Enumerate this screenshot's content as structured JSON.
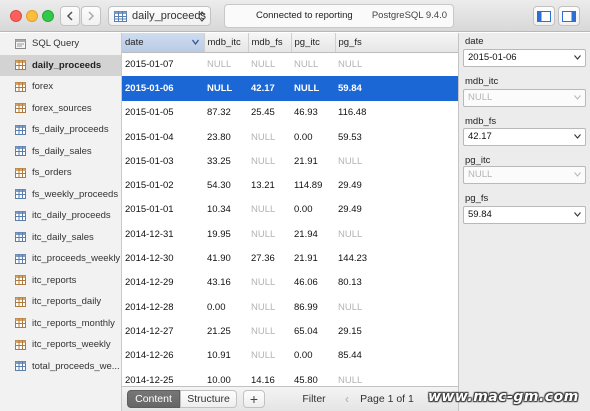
{
  "toolbar": {
    "table_selector": "daily_proceeds",
    "connection_status": "Connected to reporting",
    "server_version": "PostgreSQL 9.4.0"
  },
  "sidebar": {
    "items": [
      {
        "label": "SQL Query",
        "icon": "sql-query-icon"
      },
      {
        "label": "daily_proceeds",
        "icon": "table-icon",
        "selected": true
      },
      {
        "label": "forex",
        "icon": "table-icon"
      },
      {
        "label": "forex_sources",
        "icon": "table-icon"
      },
      {
        "label": "fs_daily_proceeds",
        "icon": "table-icon"
      },
      {
        "label": "fs_daily_sales",
        "icon": "table-icon"
      },
      {
        "label": "fs_orders",
        "icon": "table-icon"
      },
      {
        "label": "fs_weekly_proceeds",
        "icon": "table-icon"
      },
      {
        "label": "itc_daily_proceeds",
        "icon": "table-icon"
      },
      {
        "label": "itc_daily_sales",
        "icon": "table-icon"
      },
      {
        "label": "itc_proceeds_weekly",
        "icon": "table-icon"
      },
      {
        "label": "itc_reports",
        "icon": "table-icon"
      },
      {
        "label": "itc_reports_daily",
        "icon": "table-icon"
      },
      {
        "label": "itc_reports_monthly",
        "icon": "table-icon"
      },
      {
        "label": "itc_reports_weekly",
        "icon": "table-icon"
      },
      {
        "label": "total_proceeds_we...",
        "icon": "table-icon"
      }
    ]
  },
  "grid": {
    "columns": [
      "date",
      "mdb_itc",
      "mdb_fs",
      "pg_itc",
      "pg_fs"
    ],
    "rows": [
      [
        "2015-01-07",
        "NULL",
        "NULL",
        "NULL",
        "NULL"
      ],
      [
        "2015-01-06",
        "NULL",
        "42.17",
        "NULL",
        "59.84"
      ],
      [
        "2015-01-05",
        "87.32",
        "25.45",
        "46.93",
        "116.48"
      ],
      [
        "2015-01-04",
        "23.80",
        "NULL",
        "0.00",
        "59.53"
      ],
      [
        "2015-01-03",
        "33.25",
        "NULL",
        "21.91",
        "NULL"
      ],
      [
        "2015-01-02",
        "54.30",
        "13.21",
        "114.89",
        "29.49"
      ],
      [
        "2015-01-01",
        "10.34",
        "NULL",
        "0.00",
        "29.49"
      ],
      [
        "2014-12-31",
        "19.95",
        "NULL",
        "21.94",
        "NULL"
      ],
      [
        "2014-12-30",
        "41.90",
        "27.36",
        "21.91",
        "144.23"
      ],
      [
        "2014-12-29",
        "43.16",
        "NULL",
        "46.06",
        "80.13"
      ],
      [
        "2014-12-28",
        "0.00",
        "NULL",
        "86.99",
        "NULL"
      ],
      [
        "2014-12-27",
        "21.25",
        "NULL",
        "65.04",
        "29.15"
      ],
      [
        "2014-12-26",
        "10.91",
        "NULL",
        "0.00",
        "85.44"
      ],
      [
        "2014-12-25",
        "10.00",
        "14.16",
        "45.80",
        "NULL"
      ]
    ],
    "selected_row": 1,
    "sorted_column": "date"
  },
  "bottombar": {
    "content_tab": "Content",
    "structure_tab": "Structure",
    "add_label": "+",
    "filter_label": "Filter",
    "prev_label": "‹",
    "pagination": "Page 1 of 1",
    "next_label": "›"
  },
  "detail": {
    "fields": [
      {
        "label": "date",
        "value": "2015-01-06",
        "is_null": false
      },
      {
        "label": "mdb_itc",
        "value": "NULL",
        "is_null": true
      },
      {
        "label": "mdb_fs",
        "value": "42.17",
        "is_null": false
      },
      {
        "label": "pg_itc",
        "value": "NULL",
        "is_null": true
      },
      {
        "label": "pg_fs",
        "value": "59.84",
        "is_null": false
      }
    ]
  },
  "watermark": "www.mac-gm.com",
  "colors": {
    "selection": "#1b67d6",
    "null_text": "#b3b3b3"
  }
}
